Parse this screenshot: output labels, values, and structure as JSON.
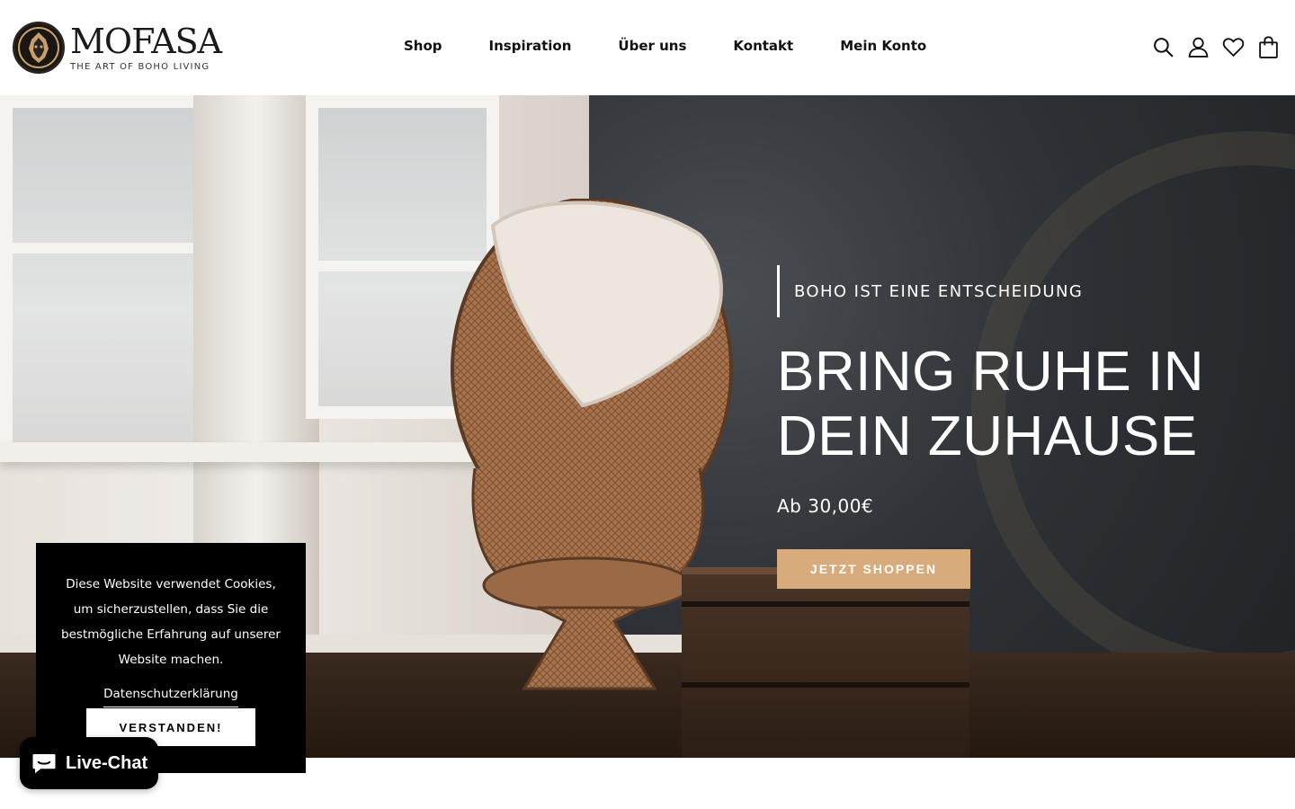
{
  "brand": {
    "name": "MOFASA",
    "tagline": "THE ART OF BOHO LIVING",
    "logo_icon": "lion-head-logo"
  },
  "nav": {
    "items": [
      {
        "label": "Shop"
      },
      {
        "label": "Inspiration"
      },
      {
        "label": "Über uns"
      },
      {
        "label": "Kontakt"
      },
      {
        "label": "Mein Konto"
      }
    ]
  },
  "header_icons": [
    "search-icon",
    "account-icon",
    "wishlist-heart-icon",
    "cart-bag-icon"
  ],
  "hero": {
    "eyebrow": "BOHO IST EINE ENTSCHEIDUNG",
    "headline_line1": "BRING RUHE IN",
    "headline_line2": "DEIN ZUHAUSE",
    "price": "Ab 30,00€",
    "cta_label": "JETZT SHOPPEN"
  },
  "cookie": {
    "text": "Diese Website verwendet Cookies, um sicherzustellen, dass Sie die bestmögliche Erfahrung auf unserer Website machen.",
    "link_label": "Datenschutzerklärung",
    "accept_label": "VERSTANDEN!"
  },
  "chat": {
    "label": "Live-Chat"
  },
  "colors": {
    "accent": "#d8ab7c",
    "text": "#111111",
    "cookie_bg": "#000000",
    "header_bg": "#ffffff"
  }
}
